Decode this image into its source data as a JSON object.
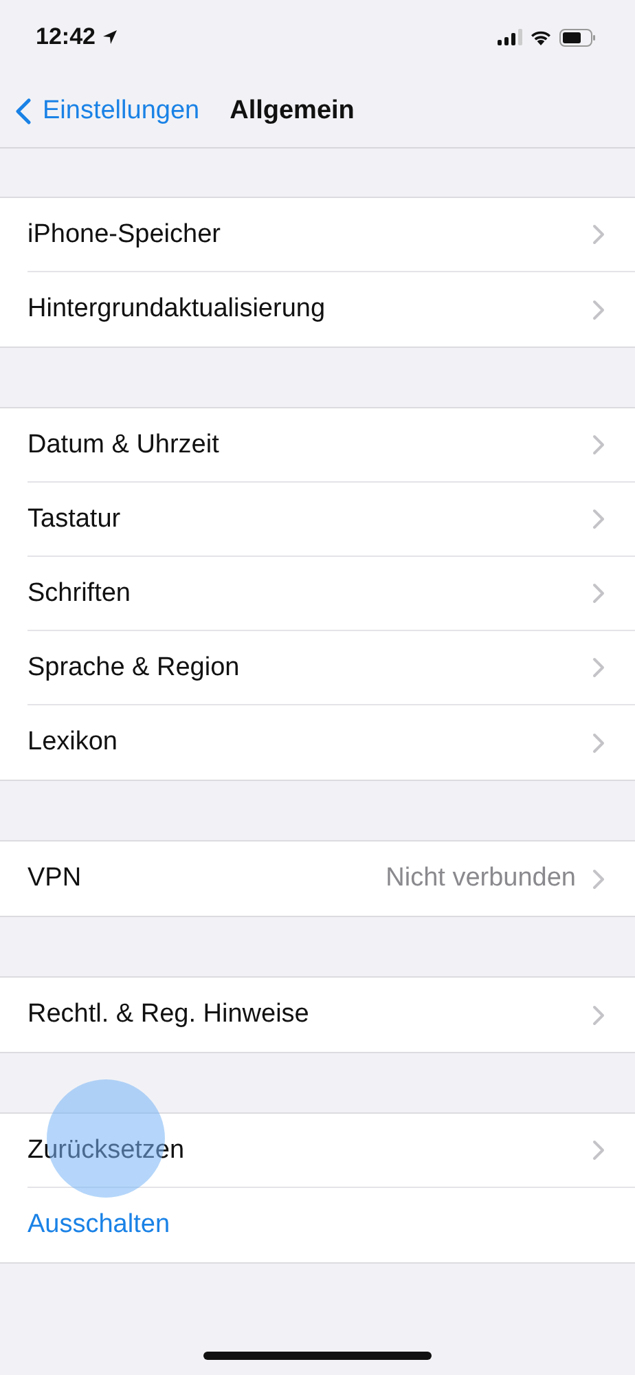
{
  "status_bar": {
    "time": "12:42"
  },
  "nav": {
    "back": "Einstellungen",
    "title": "Allgemein"
  },
  "groups": [
    {
      "rows": [
        {
          "kind": "link",
          "label": "iPhone-Speicher"
        },
        {
          "kind": "link",
          "label": "Hintergrundaktualisierung"
        }
      ]
    },
    {
      "rows": [
        {
          "kind": "link",
          "label": "Datum & Uhrzeit"
        },
        {
          "kind": "link",
          "label": "Tastatur"
        },
        {
          "kind": "link",
          "label": "Schriften"
        },
        {
          "kind": "link",
          "label": "Sprache & Region"
        },
        {
          "kind": "link",
          "label": "Lexikon"
        }
      ]
    },
    {
      "rows": [
        {
          "kind": "link",
          "label": "VPN",
          "value": "Nicht verbunden"
        }
      ]
    },
    {
      "rows": [
        {
          "kind": "link",
          "label": "Rechtl. & Reg. Hinweise"
        }
      ]
    },
    {
      "rows": [
        {
          "kind": "link",
          "label": "Zurücksetzen"
        },
        {
          "kind": "action",
          "label": "Ausschalten"
        }
      ]
    }
  ]
}
